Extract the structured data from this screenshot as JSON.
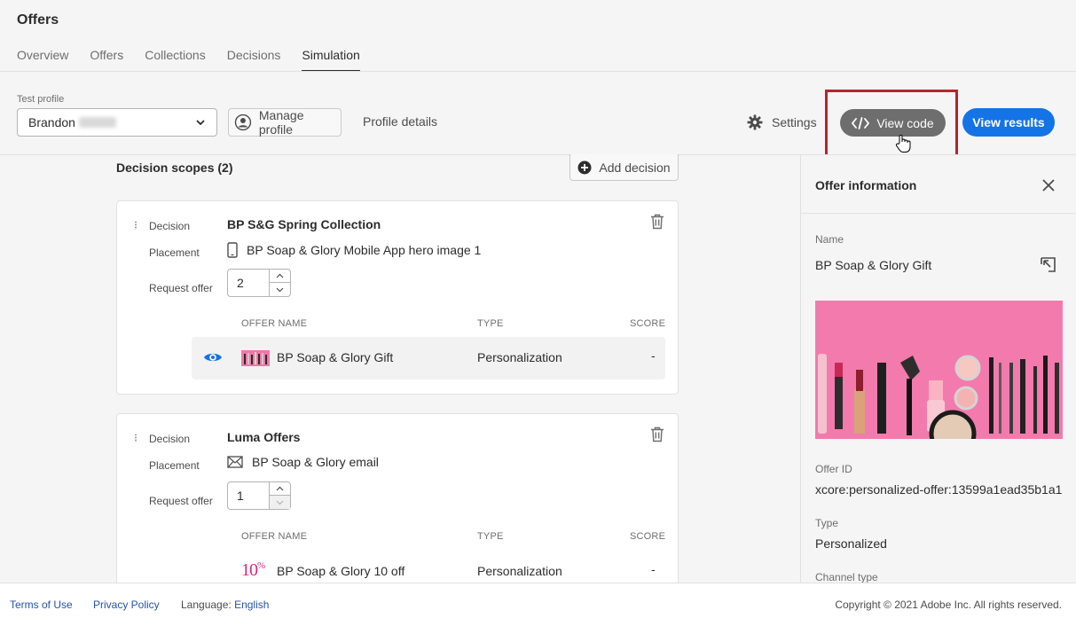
{
  "app": {
    "title": "Offers"
  },
  "tabs": [
    {
      "label": "Overview"
    },
    {
      "label": "Offers"
    },
    {
      "label": "Collections"
    },
    {
      "label": "Decisions"
    },
    {
      "label": "Simulation",
      "active": true
    }
  ],
  "toolbar": {
    "test_profile_label": "Test profile",
    "test_profile_value": "Brandon",
    "manage_profile_label": "Manage profile",
    "profile_details_label": "Profile details",
    "settings_label": "Settings",
    "view_code_label": "View code",
    "view_results_label": "View results"
  },
  "scopes": {
    "title": "Decision scopes (2)",
    "add_decision_label": "Add decision",
    "labels": {
      "decision": "Decision",
      "placement": "Placement",
      "request_offer": "Request offer"
    },
    "table_headers": {
      "offer_name": "OFFER NAME",
      "type": "TYPE",
      "score": "SCORE"
    },
    "decisions": [
      {
        "name": "BP S&G Spring Collection",
        "placement": "BP Soap & Glory Mobile App hero image 1",
        "placement_icon": "mobile-icon",
        "request_offer": "2",
        "offers": [
          {
            "name": "BP Soap & Glory Gift",
            "type": "Personalization",
            "score": "-"
          }
        ]
      },
      {
        "name": "Luma Offers",
        "placement": "BP Soap & Glory email",
        "placement_icon": "email-icon",
        "request_offer": "1",
        "offers": [
          {
            "name": "BP Soap & Glory 10 off",
            "type": "Personalization",
            "score": "-",
            "thumb_text": "10",
            "thumb_suffix": "%"
          }
        ]
      }
    ]
  },
  "panel": {
    "title": "Offer information",
    "name_label": "Name",
    "name_value": "BP Soap & Glory Gift",
    "offer_id_label": "Offer ID",
    "offer_id_value": "xcore:personalized-offer:13599a1ead35b1a1",
    "type_label": "Type",
    "type_value": "Personalized",
    "channel_type_label": "Channel type"
  },
  "footer": {
    "terms": "Terms of Use",
    "privacy": "Privacy Policy",
    "language_label": "Language:",
    "language_value": "English",
    "copyright": "Copyright © 2021 Adobe Inc. All rights reserved."
  },
  "colors": {
    "accent": "#1473e6",
    "highlight": "#b3262b",
    "view_code_bg": "#6e6e6e"
  }
}
